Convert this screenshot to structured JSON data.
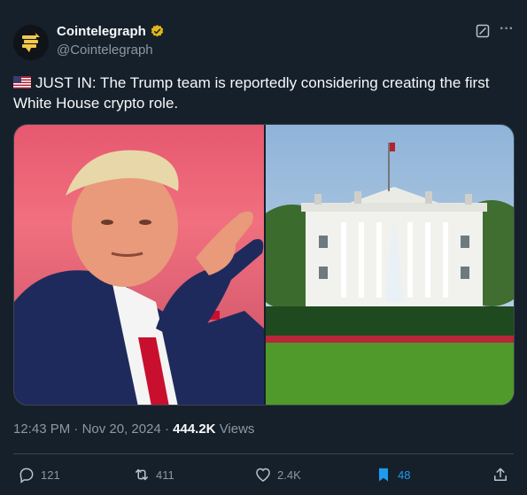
{
  "author": {
    "name": "Cointelegraph",
    "handle": "@Cointelegraph",
    "avatar_icon": "cointelegraph-logo-icon",
    "verified_icon": "gold-verified-badge-icon"
  },
  "header_icons": [
    "grok-icon",
    "more-options-icon"
  ],
  "tweet": {
    "flag_icon": "us-flag-icon",
    "text": "JUST IN: The Trump team is reportedly considering creating the first White House crypto role."
  },
  "media": {
    "left_image": "photo-person-pointing",
    "right_image": "photo-white-house"
  },
  "meta": {
    "time": "12:43 PM",
    "separator": "·",
    "date": "Nov 20, 2024",
    "views_count": "444.2K",
    "views_label": "Views"
  },
  "actions": {
    "replies": "121",
    "reposts": "411",
    "likes": "2.4K",
    "bookmarks": "48"
  },
  "colors": {
    "background": "#15202b",
    "secondary_text": "#8b98a5",
    "bookmark_active": "#1d9bf0",
    "verified_gold": "#e2b719"
  }
}
